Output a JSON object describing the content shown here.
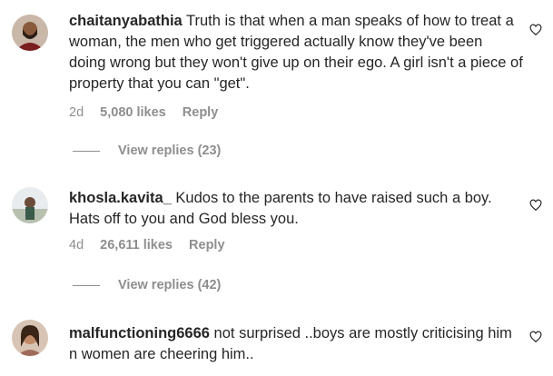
{
  "comments": [
    {
      "username": "chaitanyabathia",
      "text": "Truth is that when a man speaks of how to treat a woman, the men who get triggered actually know they've been doing wrong but they won't give up on their ego. A girl isn't a piece of property that you can \"get\".",
      "age": "2d",
      "likes": "5,080 likes",
      "reply": "Reply",
      "view_replies": "View replies (23)",
      "avatar_icon": "profile-photo-man-beard"
    },
    {
      "username": "khosla.kavita_",
      "text": "Kudos to the parents to have raised such a boy. Hats off to you and God bless you.",
      "age": "4d",
      "likes": "26,611 likes",
      "reply": "Reply",
      "view_replies": "View replies (42)",
      "avatar_icon": "profile-photo-outdoor"
    },
    {
      "username": "malfunctioning6666",
      "text": "not surprised ..boys are mostly criticising him n women are cheering him..",
      "avatar_icon": "profile-photo-woman"
    }
  ],
  "colors": {
    "text": "#262626",
    "muted": "#8e8e8e"
  }
}
